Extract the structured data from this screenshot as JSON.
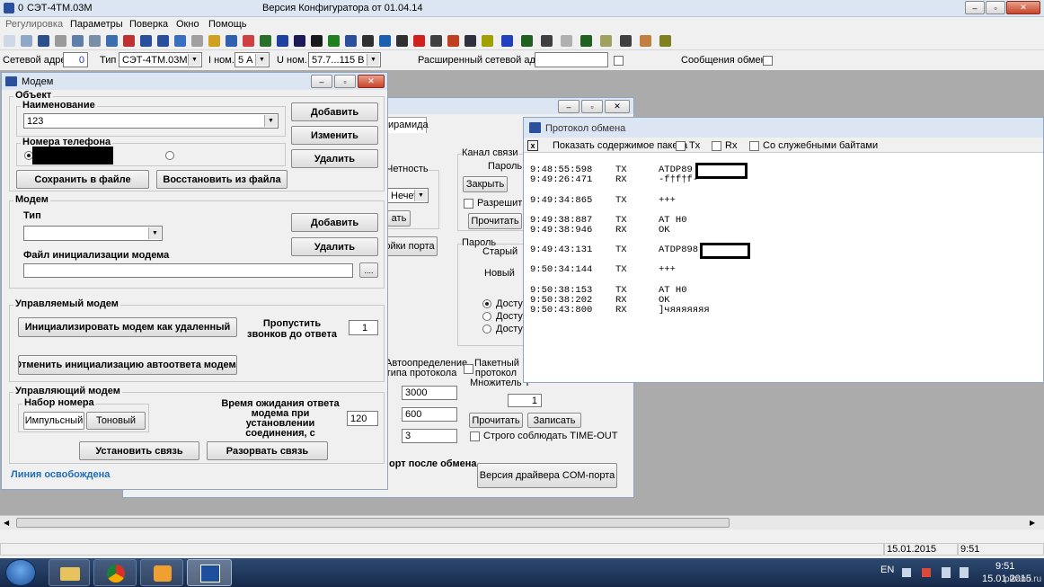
{
  "app": {
    "title_prefix": "0",
    "title_model": "СЭТ-4ТМ.03М",
    "title_version": "Версия Конфигуратора  от 01.04.14"
  },
  "menu": [
    "Регулировка",
    "Параметры",
    "Поверка",
    "Окно",
    "Помощь"
  ],
  "params_bar": {
    "network_address_label": "Сетевой адрес",
    "network_address_value": "0",
    "type_label": "Тип",
    "type_value": "СЭТ-4ТМ.03М",
    "i_nom_label": "I ном.",
    "i_nom_value": "5 А",
    "u_nom_label": "U ном.",
    "u_nom_value": "57.7...115 В",
    "extended_address_label": "Расширенный сетевой адрес",
    "exchange_messages_label": "Сообщения обмена"
  },
  "modem_window": {
    "title": "Модем",
    "object_group": "Объект",
    "name_label": "Наименование",
    "name_value": "123",
    "phone_label": "Номера телефона",
    "add_button": "Добавить",
    "edit_button": "Изменить",
    "delete_button": "Удалить",
    "save_file_button": "Сохранить в файле",
    "restore_file_button": "Восстановить из файла",
    "modem_group": "Модем",
    "type_label": "Тип",
    "modem_add_button": "Добавить",
    "modem_delete_button": "Удалить",
    "init_file_label": "Файл инициализации модема",
    "browse_button": "....",
    "managed_group": "Управляемый модем",
    "init_remote_button": "Инициализировать модем как удаленный",
    "skip_rings_label": "Пропустить звонков до ответа",
    "skip_rings_value": "1",
    "cancel_init_button": "Отменить инициализацию автоответа модема",
    "managing_group": "Управляющий модем",
    "dial_group": "Набор номера",
    "pulse_button": "Импульсный",
    "tone_button": "Тоновый",
    "wait_label": "Время ожидания ответа модема при установлении соединения, с",
    "wait_value": "120",
    "connect_button": "Установить связь",
    "disconnect_button": "Разорвать связь",
    "status": "Линия освобождена"
  },
  "middle_window": {
    "tab_label": "ирамида",
    "parity_label": "Четность",
    "parity_value": "Нечет",
    "btn_partial_1": "ать",
    "btn_partial_2": "ойки порта",
    "channel_group": "Канал связи",
    "password_label": "Пароль",
    "close_button": "Закрыть",
    "allow_label": "Разрешить",
    "read_button": "Прочитать",
    "password_group": "Пароль",
    "old_label": "Старый",
    "new_label": "Новый",
    "access_1": "Досту",
    "access_2": "Досту",
    "access_3": "Досту",
    "autodetect_label": "Автоопределение типа протокола",
    "packet_protocol_label": "Пакетный протокол",
    "multiplier_label": "Множитель Т",
    "multiplier_value": "1",
    "val_3000": "3000",
    "val_600": "600",
    "val_3": "3",
    "read2_button": "Прочитать",
    "write_button": "Записать",
    "strict_timeout_label": "Строго соблюдать TIME-OUT",
    "port_after_label": "орт после обмена",
    "driver_version_button": "Версия драйвера COM-порта"
  },
  "protocol_window": {
    "title": "Протокол обмена",
    "close_x": "x",
    "show_packet_label": "Показать содержимое пакета",
    "tx_label": "Tx",
    "rx_label": "Rx",
    "service_bytes_label": "Со служебными байтами",
    "lines": [
      {
        "time": "9:48:55:598",
        "dir": "TX",
        "data": "ATDP89"
      },
      {
        "time": "9:49:26:471",
        "dir": "RX",
        "data": "-f†f†f-"
      },
      {
        "time": "9:49:34:865",
        "dir": "TX",
        "data": "+++"
      },
      {
        "time": "9:49:38:887",
        "dir": "TX",
        "data": "AT H0"
      },
      {
        "time": "9:49:38:946",
        "dir": "RX",
        "data": "OK"
      },
      {
        "time": "9:49:43:131",
        "dir": "TX",
        "data": "ATDP898"
      },
      {
        "time": "9:50:34:144",
        "dir": "TX",
        "data": "+++"
      },
      {
        "time": "9:50:38:153",
        "dir": "TX",
        "data": "AT H0"
      },
      {
        "time": "9:50:38:202",
        "dir": "RX",
        "data": "OK"
      },
      {
        "time": "9:50:43:800",
        "dir": "RX",
        "data": "]чяяяяяяя"
      }
    ]
  },
  "statusbar": {
    "date": "15.01.2015",
    "time": "9:51"
  },
  "taskbar": {
    "lang": "EN",
    "clock_time": "9:51",
    "clock_date": "15.01.2015",
    "watermark": "pikabu.ru"
  },
  "colors": {
    "title_bar": "#dce6f2",
    "taskbar": "#1e3a5f",
    "status_link": "#1f6fb8"
  }
}
